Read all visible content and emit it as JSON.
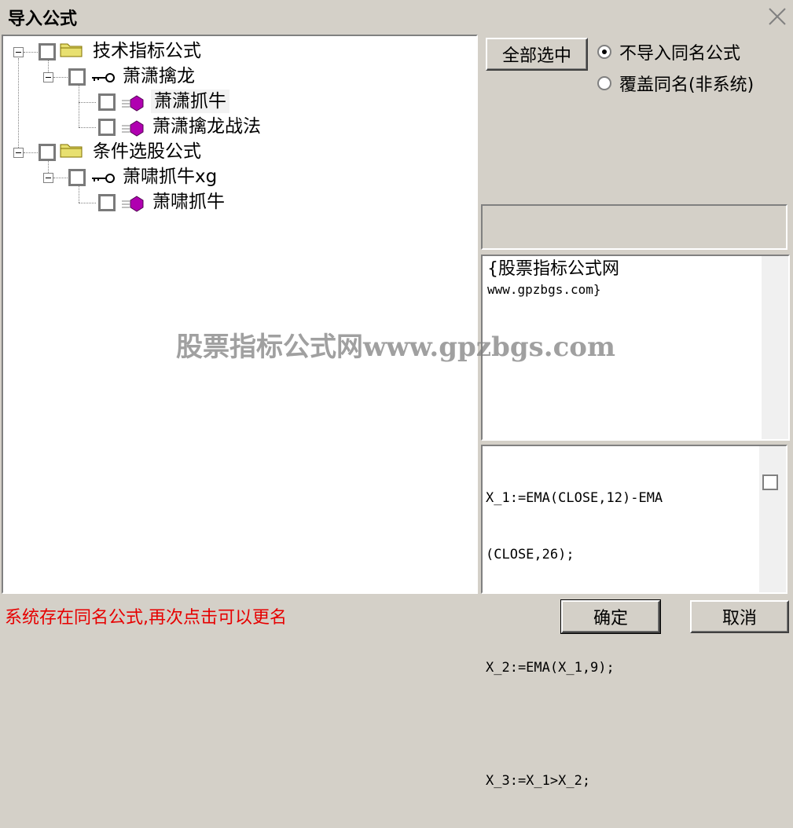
{
  "window": {
    "title": "导入公式"
  },
  "tree": {
    "groups": [
      {
        "label": "技术指标公式",
        "children": [
          {
            "label": "萧潇擒龙",
            "children": [
              {
                "label": "萧潇抓牛"
              },
              {
                "label": "萧潇擒龙战法"
              }
            ]
          }
        ]
      },
      {
        "label": "条件选股公式",
        "children": [
          {
            "label": "萧啸抓牛xg",
            "children": [
              {
                "label": "萧啸抓牛"
              }
            ]
          }
        ]
      }
    ]
  },
  "options": {
    "select_all_label": "全部选中",
    "radio_options": [
      {
        "label": "不导入同名公式",
        "checked": true
      },
      {
        "label": "覆盖同名(非系统)",
        "checked": false
      }
    ]
  },
  "description": {
    "line1": "{股票指标公式网",
    "line2": "www.gpzbgs.com}"
  },
  "code": {
    "lines": [
      "X_1:=EMA(CLOSE,12)-EMA",
      "(CLOSE,26);",
      "",
      "X_2:=EMA(X_1,9);",
      "",
      "X_3:=X_1>X_2;"
    ]
  },
  "watermark": "股票指标公式网www.gpzbgs.com",
  "status": {
    "message": "系统存在同名公式,再次点击可以更名"
  },
  "buttons": {
    "ok": "确定",
    "cancel": "取消"
  },
  "colors": {
    "dialog_bg": "#d4d0c8",
    "status_text": "#e60000",
    "formula_icon": "#b000b0",
    "folder": "#e8e070"
  }
}
